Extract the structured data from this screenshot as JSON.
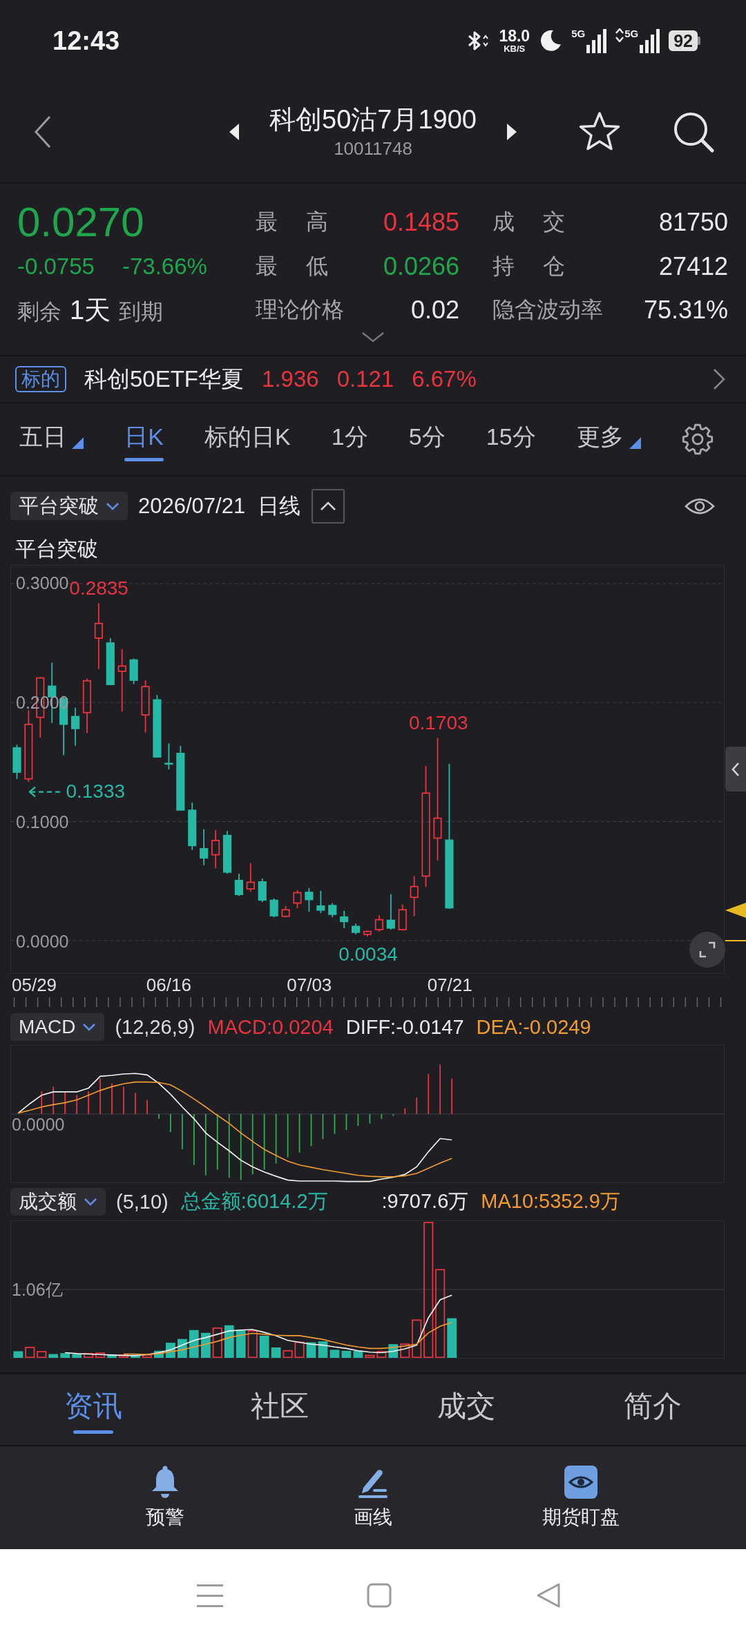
{
  "status_bar": {
    "time": "12:43",
    "net_speed": "18.0",
    "net_speed_unit": "KB/S",
    "networks": [
      {
        "label": "5G",
        "transfer": false
      },
      {
        "label": "5G",
        "transfer": true
      }
    ],
    "battery": "92"
  },
  "header": {
    "title": "科创50沽7月1900",
    "code": "10011748"
  },
  "quote": {
    "price": "0.0270",
    "color": "#1fa64c",
    "change": "-0.0755",
    "change_pct": "-73.66%",
    "expiry": {
      "prefix": "剩余",
      "days": "1天",
      "suffix": "到期"
    },
    "stats": [
      {
        "label": "最 高",
        "value": "0.1485",
        "color": "#e8343f"
      },
      {
        "label": "成 交",
        "value": "81750"
      },
      {
        "label": "最 低",
        "value": "0.0266",
        "color": "#1fa64c"
      },
      {
        "label": "持 仓",
        "value": "27412"
      },
      {
        "label": "理论价格",
        "value": "0.02"
      },
      {
        "label": "隐含波动率",
        "value": "75.31%"
      }
    ]
  },
  "underlying": {
    "tag": "标的",
    "name": "科创50ETF华夏",
    "price": "1.936",
    "change": "0.121",
    "change_pct": "6.67%",
    "color": "#e8343f"
  },
  "period_tabs": [
    {
      "label": "五日",
      "selected": false,
      "dropdown": true
    },
    {
      "label": "日K",
      "selected": true,
      "dropdown": false
    },
    {
      "label": "标的日K",
      "selected": false,
      "dropdown": false
    },
    {
      "label": "1分",
      "selected": false,
      "dropdown": false
    },
    {
      "label": "5分",
      "selected": false,
      "dropdown": false
    },
    {
      "label": "15分",
      "selected": false,
      "dropdown": false
    },
    {
      "label": "更多",
      "selected": false,
      "dropdown": true
    }
  ],
  "chart_toolbar": {
    "indicator": "平台突破",
    "date": "2026/07/21",
    "period": "日线"
  },
  "price_chart": {
    "title": "平台突破",
    "chart_data": {
      "type": "candlestick",
      "categories": [
        null,
        "05/29",
        null,
        null,
        null,
        null,
        null,
        null,
        null,
        null,
        null,
        null,
        null,
        "06/16",
        null,
        null,
        null,
        null,
        null,
        null,
        null,
        null,
        null,
        null,
        null,
        "07/03",
        null,
        null,
        null,
        null,
        null,
        null,
        null,
        null,
        null,
        null,
        null,
        "07/21",
        null,
        null,
        null,
        null,
        null,
        null,
        null,
        null,
        null,
        null,
        null,
        null,
        null,
        null,
        null,
        null,
        null,
        null,
        null,
        null,
        null,
        null,
        null
      ],
      "ohlc": [
        [
          0.1625,
          0.1645,
          0.1359,
          0.141
        ],
        [
          0.1359,
          0.1936,
          0.1333,
          0.1817
        ],
        [
          0.1876,
          0.2215,
          0.1705,
          0.2207
        ],
        [
          0.2143,
          0.2335,
          0.1829,
          0.2044
        ],
        [
          0.2036,
          0.2056,
          0.1558,
          0.1813
        ],
        [
          0.1888,
          0.1956,
          0.1637,
          0.1777
        ],
        [
          0.1916,
          0.2203,
          0.1745,
          0.2183
        ],
        [
          0.2542,
          0.2835,
          0.2283,
          0.2665
        ],
        [
          0.2506,
          0.2542,
          0.2147,
          0.2147
        ],
        [
          0.2263,
          0.245,
          0.1924,
          0.2307
        ],
        [
          0.2363,
          0.2371,
          0.2155,
          0.2183
        ],
        [
          0.1896,
          0.2187,
          0.1749,
          0.2135
        ],
        [
          0.2028,
          0.2064,
          0.1538,
          0.1538
        ],
        [
          0.1494,
          0.1657,
          0.1438,
          0.1478
        ],
        [
          0.1578,
          0.1637,
          0.1092,
          0.1092
        ],
        [
          0.11,
          0.1159,
          0.0761,
          0.0793
        ],
        [
          0.0777,
          0.0936,
          0.0633,
          0.0689
        ],
        [
          0.0721,
          0.0928,
          0.061,
          0.0841
        ],
        [
          0.0888,
          0.092,
          0.0562,
          0.057
        ],
        [
          0.051,
          0.0562,
          0.0375,
          0.0382
        ],
        [
          0.0434,
          0.0649,
          0.041,
          0.049
        ],
        [
          0.0498,
          0.0522,
          0.0323,
          0.0335
        ],
        [
          0.0343,
          0.0355,
          0.0195,
          0.0203
        ],
        [
          0.0203,
          0.0291,
          0.0195,
          0.0259
        ],
        [
          0.0315,
          0.0422,
          0.0271,
          0.0402
        ],
        [
          0.041,
          0.0442,
          0.0243,
          0.0339
        ],
        [
          0.0295,
          0.0418,
          0.0231,
          0.0251
        ],
        [
          0.0299,
          0.0315,
          0.0195,
          0.0215
        ],
        [
          0.0203,
          0.0251,
          0.0104,
          0.0155
        ],
        [
          0.0124,
          0.0143,
          0.0052,
          0.0064
        ],
        [
          0.0052,
          0.0084,
          0.0034,
          0.0076
        ],
        [
          0.0092,
          0.0211,
          0.0076,
          0.0175
        ],
        [
          0.0175,
          0.039,
          0.0092,
          0.01
        ],
        [
          0.0092,
          0.0303,
          0.0084,
          0.0259
        ],
        [
          0.0363,
          0.0542,
          0.0203,
          0.0454
        ],
        [
          0.0542,
          0.1466,
          0.045,
          0.1239
        ],
        [
          0.0861,
          0.1703,
          0.0673,
          0.1028
        ],
        [
          0.0849,
          0.1485,
          0.0266,
          0.027
        ],
        null,
        null,
        null,
        null,
        null,
        null,
        null,
        null,
        null,
        null,
        null,
        null,
        null,
        null,
        null,
        null,
        null,
        null,
        null,
        null,
        null,
        null,
        null
      ],
      "ylim": [
        -0.0274,
        0.3151
      ],
      "yticks": [
        {
          "value": 0.3,
          "label": "0.3000"
        },
        {
          "value": 0.2,
          "label": "0.2000"
        },
        {
          "value": 0.1,
          "label": "0.1000"
        },
        {
          "value": 0,
          "label": "0.0000"
        }
      ],
      "grid": true,
      "annotations": [
        "0.2835",
        "0.1703",
        "0.1333",
        "0.0034"
      ]
    }
  },
  "macd_panel": {
    "indicator": "MACD",
    "params": "(12,26,9)",
    "values": [
      {
        "text": "MACD:0.0204",
        "kind": "macd"
      },
      {
        "text": "DIFF:-0.0147",
        "kind": "diff"
      },
      {
        "text": "DEA:-0.0249",
        "kind": "dea"
      }
    ],
    "axis_label": "0.0000"
  },
  "volume_panel": {
    "indicator": "成交额",
    "params": "(5,10)",
    "values": [
      {
        "text": "总金额:6014.2万",
        "kind": "total"
      },
      {
        "text": ":9707.6万",
        "kind": "ma5"
      },
      {
        "text": "MA10:5352.9万",
        "kind": "ma10"
      }
    ],
    "axis_label": "1.06亿"
  },
  "bottom_tabs": [
    {
      "label": "资讯",
      "selected": true
    },
    {
      "label": "社区",
      "selected": false
    },
    {
      "label": "成交",
      "selected": false
    },
    {
      "label": "简介",
      "selected": false
    }
  ],
  "actions": [
    {
      "label": "预警",
      "kind": "alert"
    },
    {
      "label": "画线",
      "kind": "draw"
    },
    {
      "label": "期货盯盘",
      "kind": "watch"
    }
  ]
}
